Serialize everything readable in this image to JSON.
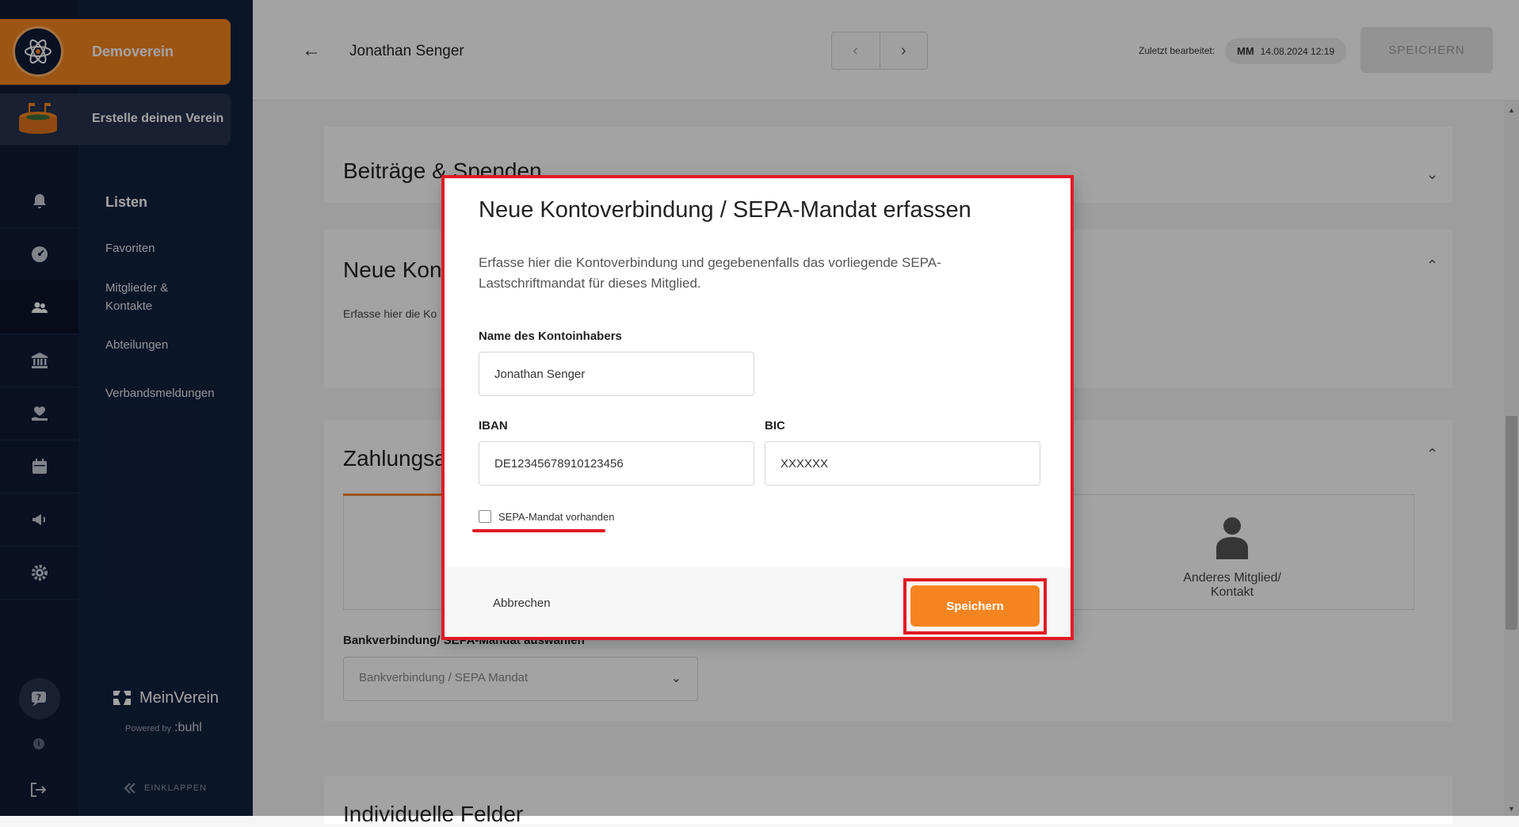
{
  "sidebar": {
    "club_name": "Demoverein",
    "create_club_label": "Erstelle deinen Verein",
    "nav_title": "Listen",
    "nav_links": [
      "Favoriten",
      "Mitglieder & Kontakte",
      "Abteilungen",
      "Verbandsmeldungen"
    ],
    "rail_icons": [
      "bell-icon",
      "dashboard-icon",
      "members-icon",
      "bank-icon",
      "donation-icon",
      "calendar-icon",
      "megaphone-icon",
      "gear-icon"
    ],
    "brand_name": "MeinVerein",
    "powered_by": "Powered by",
    "powered_brand": ":buhl",
    "collapse_label": "EINKLAPPEN"
  },
  "header": {
    "member_name": "Jonathan Senger",
    "edited_label": "Zuletzt bearbeitet:",
    "edited_initials": "MM",
    "edited_timestamp": "14.08.2024 12:19",
    "save_label": "SPEICHERN"
  },
  "sections": {
    "contributions_title": "Beiträge & Spenden",
    "account_title": "Neue Kont",
    "account_desc": "Erfasse hier die Ko",
    "payment_title": "Zahlungsa",
    "other_member_label": "Anderes Mitglied/ Kontakt",
    "bank_label": "Bankverbindung/ SEPA-Mandat auswählen",
    "bank_placeholder": "Bankverbindung / SEPA Mandat",
    "custom_fields_title": "Individuelle Felder"
  },
  "modal": {
    "title": "Neue Kontoverbindung / SEPA-Mandat erfassen",
    "intro": "Erfasse hier die Kontoverbindung und gegebenenfalls das vorliegende SEPA-Lastschriftmandat für dieses Mitglied.",
    "holder_label": "Name des Kontoinhabers",
    "holder_value": "Jonathan Senger",
    "iban_label": "IBAN",
    "iban_value": "DE12345678910123456",
    "bic_label": "BIC",
    "bic_value": "XXXXXX",
    "sepa_checkbox_label": "SEPA-Mandat vorhanden",
    "sepa_checked": false,
    "cancel_label": "Abbrechen",
    "save_label": "Speichern"
  },
  "colors": {
    "accent": "#f6851f",
    "sidebar_bg": "#0f1b36",
    "highlight": "#e01b24"
  }
}
